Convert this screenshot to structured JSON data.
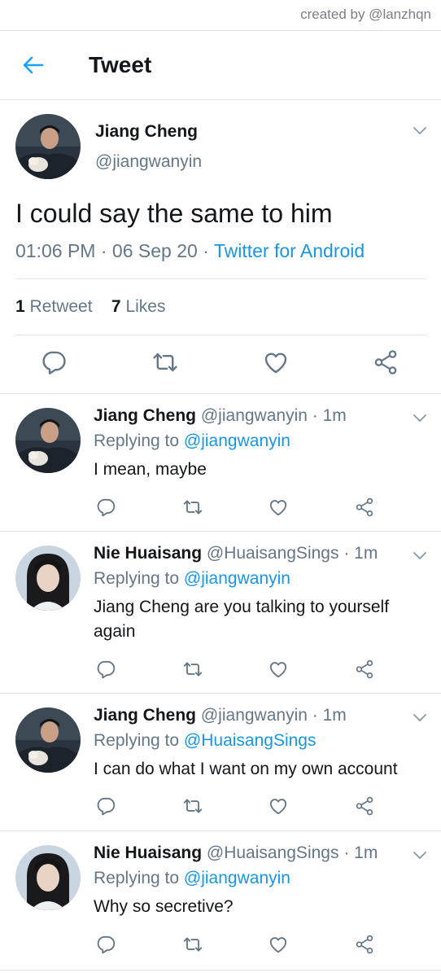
{
  "credit": "created by @lanzhqn",
  "header": {
    "title": "Tweet"
  },
  "main_tweet": {
    "name": "Jiang Cheng",
    "handle": "@jiangwanyin",
    "text": "I could say the same to him",
    "time": "01:06 PM",
    "date": "06 Sep 20",
    "source": "Twitter for Android",
    "sep": "·",
    "retweet_count": "1",
    "retweet_label": "Retweet",
    "like_count": "7",
    "like_label": "Likes"
  },
  "replies": [
    {
      "name": "Jiang Cheng",
      "handle": "@jiangwanyin",
      "time": "· 1m",
      "replying_label": "Replying to",
      "replying_to": "@jiangwanyin",
      "text": "I mean, maybe",
      "avatar": "jiang"
    },
    {
      "name": "Nie Huaisang",
      "handle": "@HuaisangSings",
      "time": "· 1m",
      "replying_label": "Replying to",
      "replying_to": "@jiangwanyin",
      "text": "Jiang Cheng are you talking to yourself again",
      "avatar": "nie"
    },
    {
      "name": "Jiang Cheng",
      "handle": "@jiangwanyin",
      "time": "· 1m",
      "replying_label": "Replying to",
      "replying_to": "@HuaisangSings",
      "text": "I can do what I want on my own account",
      "avatar": "jiang"
    },
    {
      "name": "Nie Huaisang",
      "handle": "@HuaisangSings",
      "time": "· 1m",
      "replying_label": "Replying to",
      "replying_to": "@jiangwanyin",
      "text": "Why so secretive?",
      "avatar": "nie"
    }
  ],
  "colors": {
    "link": "#1b95e0",
    "muted": "#657786",
    "text": "#14171a",
    "divider": "#e1e6ea"
  },
  "icons": [
    "back-arrow-icon",
    "chevron-down-icon",
    "reply-icon",
    "retweet-icon",
    "like-icon",
    "share-icon"
  ]
}
